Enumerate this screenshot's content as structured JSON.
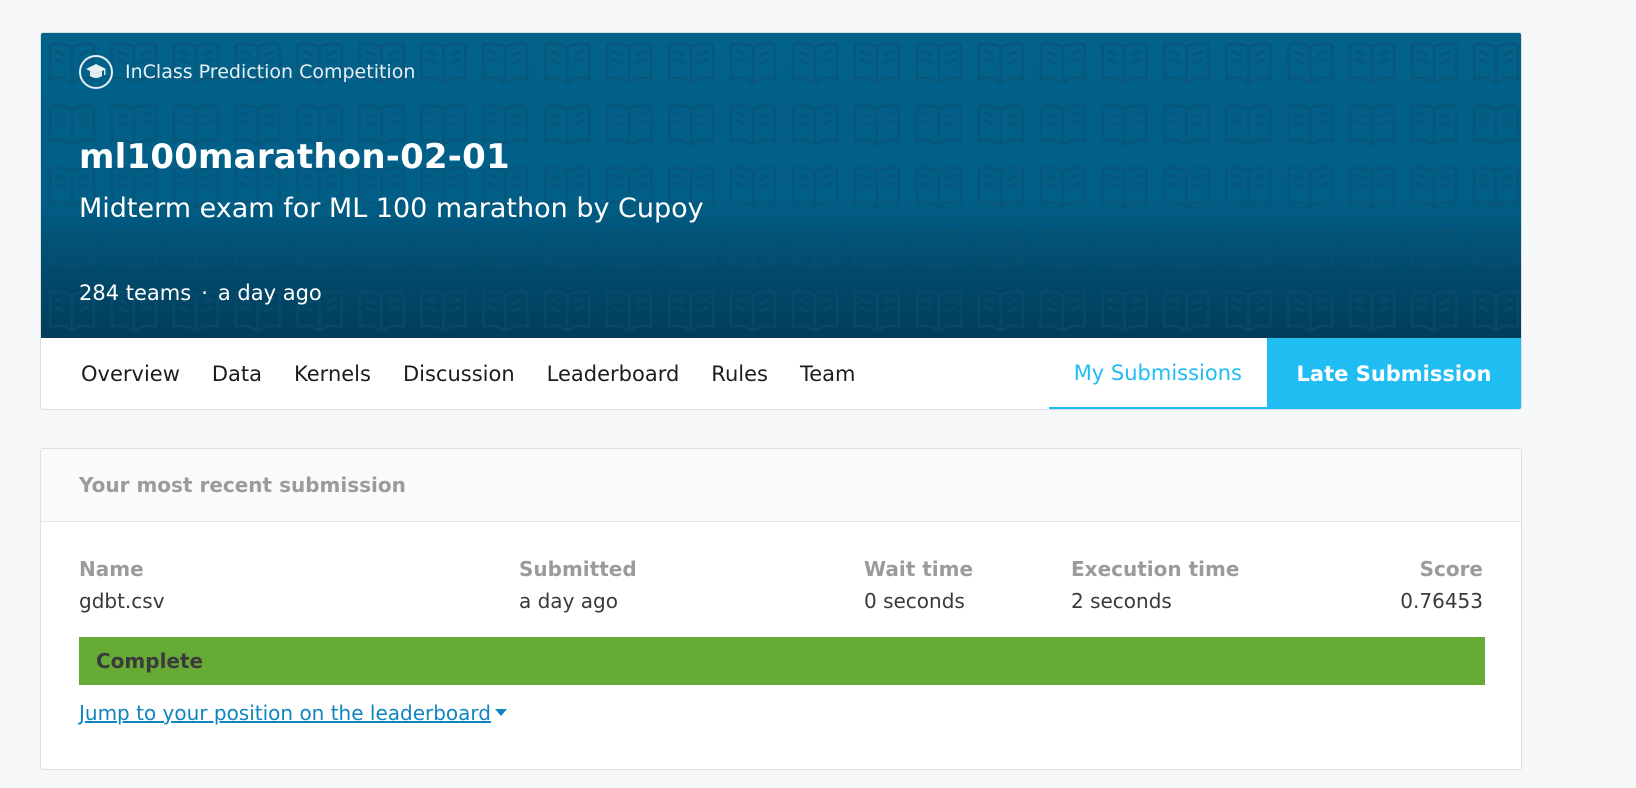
{
  "competition": {
    "type_label": "InClass Prediction Competition",
    "title": "ml100marathon-02-01",
    "subtitle": "Midterm exam for ML 100 marathon by Cupoy",
    "teams": "284 teams",
    "separator": "·",
    "updated": "a day ago"
  },
  "tabs": [
    {
      "label": "Overview"
    },
    {
      "label": "Data"
    },
    {
      "label": "Kernels"
    },
    {
      "label": "Discussion"
    },
    {
      "label": "Leaderboard"
    },
    {
      "label": "Rules"
    },
    {
      "label": "Team"
    }
  ],
  "my_submissions_label": "My Submissions",
  "late_submission_label": "Late Submission",
  "recent_submission": {
    "heading": "Your most recent submission",
    "columns": {
      "name_label": "Name",
      "name_value": "gdbt.csv",
      "submitted_label": "Submitted",
      "submitted_value": "a day ago",
      "wait_label": "Wait time",
      "wait_value": "0 seconds",
      "exec_label": "Execution time",
      "exec_value": "2 seconds",
      "score_label": "Score",
      "score_value": "0.76453"
    },
    "status": "Complete",
    "jump_link": "Jump to your position on the leaderboard"
  },
  "colors": {
    "banner": "#03628a",
    "accent": "#20bdf3",
    "complete": "#67ab37",
    "link": "#0f86c0"
  },
  "icons": {
    "competition_type": "graduation-cap-icon",
    "jump_caret": "caret-down-icon"
  }
}
